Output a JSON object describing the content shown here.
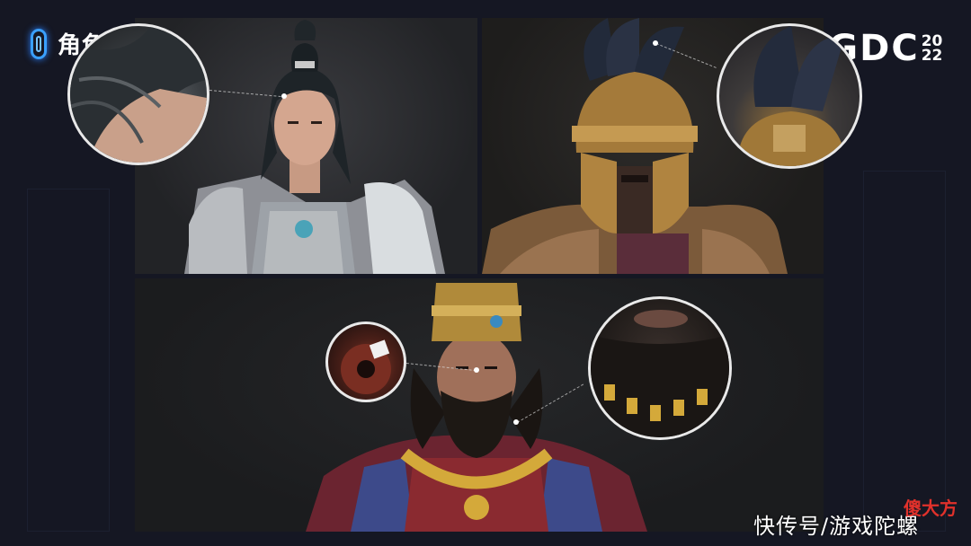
{
  "slide": {
    "title": "角色毛发",
    "brand": "TGDC",
    "year_top": "20",
    "year_bottom": "22"
  },
  "watermark": {
    "text": "快传号/游戏陀螺",
    "stamp": "傻大方"
  },
  "colors": {
    "background": "#151723",
    "accent": "#3aa0ff",
    "stamp": "#e0312b"
  },
  "panels": [
    {
      "name": "character-panel-warrior",
      "zoom": "hair-closeup"
    },
    {
      "name": "character-panel-helmet",
      "zoom": "helmet-plume-closeup"
    },
    {
      "name": "character-panel-king",
      "zoom": [
        "eye-closeup",
        "beard-closeup"
      ]
    }
  ]
}
